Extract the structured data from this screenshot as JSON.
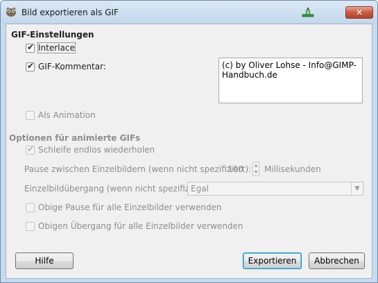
{
  "window": {
    "title": "Bild exportieren als GIF",
    "close_label": "✕"
  },
  "gif_settings": {
    "heading": "GIF-Einstellungen",
    "interlace": {
      "label": "Interlace",
      "checked": true
    },
    "comment": {
      "label": "GIF-Kommentar:",
      "checked": true,
      "value": "(c) by Oliver Lohse - Info@GIMP-\nHandbuch.de"
    },
    "animation": {
      "label": "Als Animation",
      "checked": false,
      "enabled": false
    }
  },
  "animation_options": {
    "heading": "Optionen für animierte GIFs",
    "loop": {
      "label": "Schleife endlos wiederholen",
      "checked": true
    },
    "delay": {
      "label": "Pause zwischen Einzelbildern (wenn nicht spezifiziert):",
      "value": "100",
      "unit": "Millisekunden"
    },
    "disposal": {
      "label": "Einzelbildübergang (wenn nicht spezifiziert):",
      "value": "Egal",
      "arrow": "▼"
    },
    "use_delay_all": {
      "label": "Obige Pause für alle Einzelbilder verwenden",
      "checked": false
    },
    "use_disposal_all": {
      "label": "Obigen Übergang für alle Einzelbilder verwenden",
      "checked": false
    }
  },
  "buttons": {
    "help": "Hilfe",
    "export": "Exportieren",
    "cancel": "Abbrechen"
  },
  "colors": {
    "title_bar": "#c3d7ec",
    "dialog_bg": "#f0f0f0",
    "default_button_border": "#3c7fb1"
  }
}
